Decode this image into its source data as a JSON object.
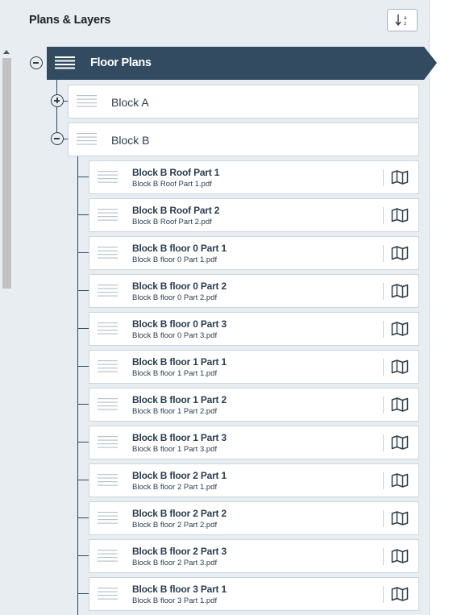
{
  "panel": {
    "title": "Plans & Layers",
    "sort_icon": "sort-ascending-icon"
  },
  "root": {
    "label": "Floor Plans",
    "state": "expanded"
  },
  "groups": [
    {
      "label": "Block A",
      "state": "collapsed"
    },
    {
      "label": "Block B",
      "state": "expanded"
    }
  ],
  "items": [
    {
      "name": "Block B Roof Part 1",
      "file": "Block B Roof Part 1.pdf"
    },
    {
      "name": "Block B Roof Part 2",
      "file": "Block B Roof Part 2.pdf"
    },
    {
      "name": "Block B floor 0 Part 1",
      "file": "Block B floor 0 Part 1.pdf"
    },
    {
      "name": "Block B floor 0 Part 2",
      "file": "Block B floor 0 Part 2.pdf"
    },
    {
      "name": "Block B floor 0 Part 3",
      "file": "Block B floor 0 Part 3.pdf"
    },
    {
      "name": "Block B floor 1 Part 1",
      "file": "Block B floor 1 Part 1.pdf"
    },
    {
      "name": "Block B floor 1 Part 2",
      "file": "Block B floor 1 Part 2.pdf"
    },
    {
      "name": "Block B floor 1 Part 3",
      "file": "Block B floor 1 Part 3.pdf"
    },
    {
      "name": "Block B floor 2 Part 1",
      "file": "Block B floor 2 Part 1.pdf"
    },
    {
      "name": "Block B floor 2 Part 2",
      "file": "Block B floor 2 Part 2.pdf"
    },
    {
      "name": "Block B floor 2 Part 3",
      "file": "Block B floor 2 Part 3.pdf"
    },
    {
      "name": "Block B floor 3 Part 1",
      "file": "Block B floor 3 Part 1.pdf"
    }
  ],
  "colors": {
    "root_bg": "#324b61",
    "panel_bg": "#e8edf1",
    "text": "#2c3e50"
  }
}
